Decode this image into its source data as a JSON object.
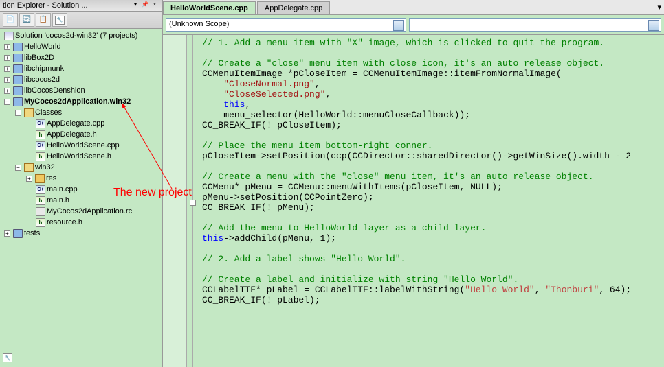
{
  "explorer": {
    "title": "tion Explorer - Solution ...",
    "pin": "▾",
    "close": "×",
    "solution": "Solution 'cocos2d-win32' (7 projects)",
    "projects": [
      {
        "name": "HelloWorld",
        "bold": false
      },
      {
        "name": "libBox2D",
        "bold": false
      },
      {
        "name": "libchipmunk",
        "bold": false
      },
      {
        "name": "libcocos2d",
        "bold": false
      },
      {
        "name": "libCocosDenshion",
        "bold": false
      },
      {
        "name": "MyCocos2dApplication.win32",
        "bold": true
      },
      {
        "name": "tests",
        "bold": false
      }
    ],
    "myproj_folders": {
      "classes": {
        "label": "Classes",
        "items": [
          {
            "name": "AppDelegate.cpp",
            "kind": "cpp"
          },
          {
            "name": "AppDelegate.h",
            "kind": "h"
          },
          {
            "name": "HelloWorldScene.cpp",
            "kind": "cpp"
          },
          {
            "name": "HelloWorldScene.h",
            "kind": "h"
          }
        ]
      },
      "win32": {
        "label": "win32",
        "items": [
          {
            "name": "res",
            "kind": "folder"
          },
          {
            "name": "main.cpp",
            "kind": "cpp"
          },
          {
            "name": "main.h",
            "kind": "h"
          },
          {
            "name": "MyCocos2dApplication.rc",
            "kind": "rc"
          },
          {
            "name": "resource.h",
            "kind": "h"
          }
        ]
      }
    }
  },
  "tabs": {
    "active": "HelloWorldScene.cpp",
    "inactive": "AppDelegate.cpp"
  },
  "scope": {
    "selected": "(Unknown Scope)"
  },
  "annotation": "The new project",
  "code": {
    "lines": [
      {
        "t": "",
        "cls": ""
      },
      {
        "t": "// 1. Add a menu item with \"X\" image, which is clicked to quit the program.",
        "cls": "c-comment"
      },
      {
        "t": "",
        "cls": ""
      },
      {
        "t": "// Create a \"close\" menu item with close icon, it's an auto release object.",
        "cls": "c-comment"
      }
    ],
    "line5_a": "CCMenuItemImage *pCloseItem = CCMenuItemImage::itemFromNormalImage(",
    "line6_s": "\"CloseNormal.png\"",
    "line7_s": "\"CloseSelected.png\"",
    "line8_k": "this",
    "line9": "menu_selector(HelloWorld::menuCloseCallback));",
    "line10": "CC_BREAK_IF(! pCloseItem);",
    "line12": "// Place the menu item bottom-right conner.",
    "line13": "pCloseItem->setPosition(ccp(CCDirector::sharedDirector()->getWinSize().width - 2",
    "line15": "// Create a menu with the \"close\" menu item, it's an auto release object.",
    "line16": "CCMenu* pMenu = CCMenu::menuWithItems(pCloseItem, NULL);",
    "line17": "pMenu->setPosition(CCPointZero);",
    "line18": "CC_BREAK_IF(! pMenu);",
    "line20": "// Add the menu to HelloWorld layer as a child layer.",
    "line21_k": "this",
    "line21_r": "->addChild(pMenu, 1);",
    "line23": "// 2. Add a label shows \"Hello World\".",
    "line25": "// Create a label and initialize with string \"Hello World\".",
    "line26_a": "CCLabelTTF* pLabel = CCLabelTTF::labelWithString(",
    "line26_s1": "\"Hello World\"",
    "line26_s2": "\"Thonburi\"",
    "line26_r": ", 64);",
    "line27": "CC_BREAK_IF(! pLabel);"
  }
}
